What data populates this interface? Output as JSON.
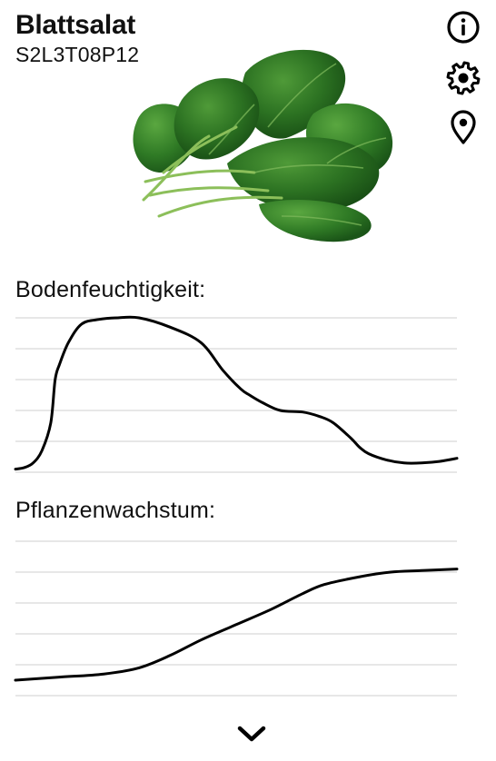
{
  "plant": {
    "name": "Blattsalat",
    "id": "S2L3T08P12",
    "image": "spinach-leaves"
  },
  "icons": {
    "info": "info-icon",
    "settings": "gear-icon",
    "location": "location-pin-icon",
    "expand": "chevron-down-icon"
  },
  "sections": {
    "soil_label": "Bodenfeuchtigkeit:",
    "growth_label": "Pflanzenwachstum:"
  },
  "chart_data": [
    {
      "type": "line",
      "title": "Bodenfeuchtigkeit:",
      "grid": true,
      "ylim": [
        0,
        5
      ],
      "x": [
        0,
        2,
        4,
        6,
        8,
        9,
        10,
        12,
        15,
        19,
        23,
        28,
        35,
        42,
        47,
        51,
        53,
        56,
        60,
        65,
        69,
        72,
        76,
        78,
        80,
        84,
        88,
        92,
        96,
        100
      ],
      "series": [
        {
          "values": [
            0.1,
            0.15,
            0.3,
            0.7,
            1.6,
            3.0,
            3.5,
            4.2,
            4.8,
            4.95,
            5.0,
            5.0,
            4.7,
            4.2,
            3.3,
            2.7,
            2.5,
            2.25,
            2.0,
            1.95,
            1.8,
            1.6,
            1.1,
            0.8,
            0.6,
            0.4,
            0.3,
            0.3,
            0.35,
            0.45
          ],
          "color": "#000000"
        }
      ]
    },
    {
      "type": "line",
      "title": "Pflanzenwachstum:",
      "grid": true,
      "ylim": [
        0,
        5
      ],
      "x": [
        0,
        10,
        20,
        28,
        35,
        42,
        50,
        58,
        65,
        70,
        78,
        85,
        92,
        100
      ],
      "series": [
        {
          "values": [
            0.5,
            0.6,
            0.7,
            0.9,
            1.3,
            1.8,
            2.3,
            2.8,
            3.3,
            3.6,
            3.85,
            4.0,
            4.05,
            4.1
          ],
          "color": "#000000"
        }
      ]
    }
  ]
}
